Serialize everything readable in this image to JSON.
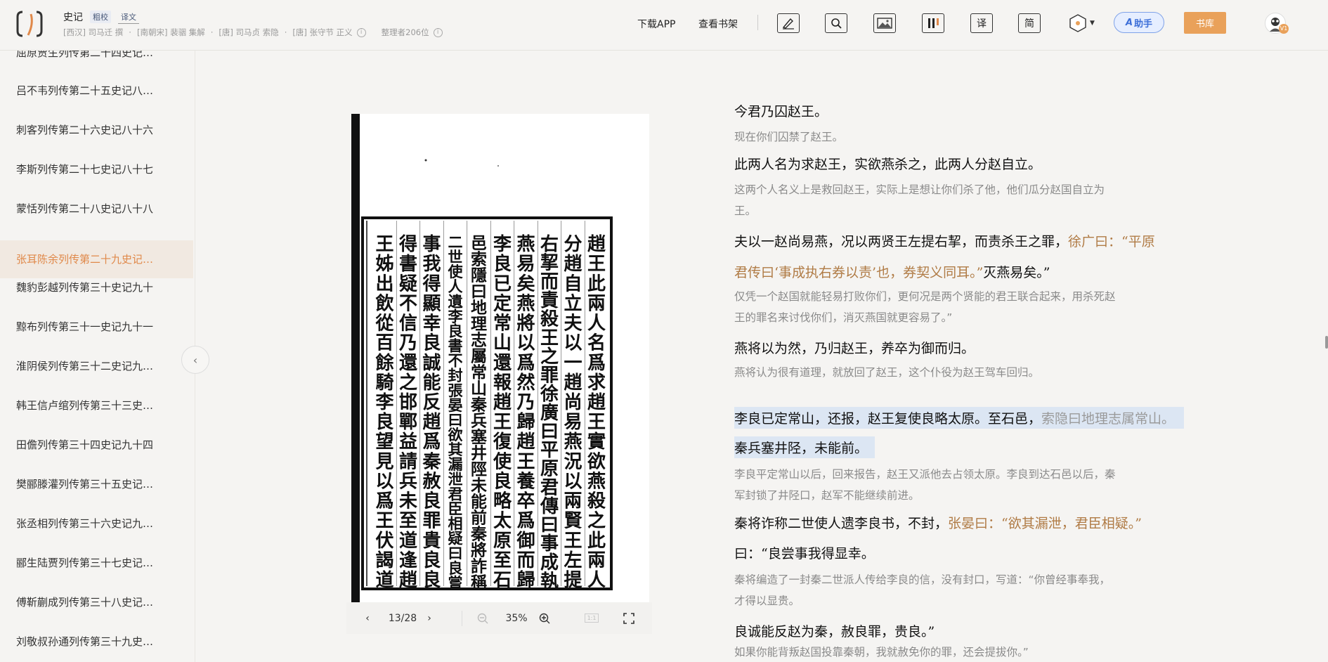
{
  "header": {
    "book_title": "史记",
    "tag_collate": "粗校",
    "tag_translate": "译文",
    "authors": [
      "[西汉] 司马迁 撰",
      "[南朝宋] 裴骃 集解",
      "[唐] 司马贞 索隐",
      "[唐] 张守节 正义"
    ],
    "editors": "整理者206位",
    "download_app": "下载APP",
    "view_shelf": "查看书架",
    "tools": [
      {
        "name": "annotate-icon",
        "glyph": "✎"
      },
      {
        "name": "search-icon",
        "glyph": "⌕"
      },
      {
        "name": "image-icon",
        "glyph": "▨"
      },
      {
        "name": "columns-icon",
        "glyph": "▥"
      },
      {
        "name": "translate-icon",
        "glyph": "译"
      },
      {
        "name": "simplified-icon",
        "glyph": "简"
      }
    ],
    "ai_label": "助手",
    "library_label": "书库",
    "avatar_badge": "V1",
    "colors": {
      "accent": "#e9a15a",
      "ai": "#3d6fd8",
      "note": "#b07b45",
      "highlight": "#dce6f3"
    }
  },
  "sidebar": {
    "items": [
      {
        "label": "屈原贾生列传第二十四史记…",
        "active": false
      },
      {
        "label": "吕不韦列传第二十五史记八…",
        "active": false
      },
      {
        "label": "刺客列传第二十六史记八十六",
        "active": false
      },
      {
        "label": "李斯列传第二十七史记八十七",
        "active": false
      },
      {
        "label": "蒙恬列传第二十八史记八十八",
        "active": false
      },
      {
        "label": "张耳陈余列传第二十九史记…",
        "active": true
      },
      {
        "label": "魏豹彭越列传第三十史记九十",
        "active": false
      },
      {
        "label": "黥布列传第三十一史记九十一",
        "active": false
      },
      {
        "label": "淮阴侯列传第三十二史记九…",
        "active": false
      },
      {
        "label": "韩王信卢绾列传第三十三史…",
        "active": false
      },
      {
        "label": "田儋列传第三十四史记九十四",
        "active": false
      },
      {
        "label": "樊郦滕灌列传第三十五史记…",
        "active": false
      },
      {
        "label": "张丞相列传第三十六史记九…",
        "active": false
      },
      {
        "label": "郦生陆贾列传第三十七史记…",
        "active": false
      },
      {
        "label": "傅靳蒯成列传第三十八史记…",
        "active": false
      },
      {
        "label": "刘敬叔孙通列传第三十九史…",
        "active": false
      }
    ]
  },
  "viewer": {
    "page_indicator": "13/28",
    "zoom": "35%",
    "ratio_label": "1:1",
    "scan_columns": [
      "趙王此兩人名爲求趙王實欲燕殺之此兩人",
      "分趙自立夫以一趙尚易燕況以兩賢王左提",
      "右挈而責殺王之罪徐廣曰平原君傳曰事成執",
      "燕易矣燕將以爲然乃歸趙王養卒爲御而歸",
      "李良已定常山還報趙王復使良略太原至石",
      "邑索隱曰地理志屬常山秦兵塞井陘未能前秦將詐稱",
      "二世使人遺李良書不封張晏曰欲其漏泄君臣相疑曰良嘗",
      "事我得顯幸良誠能反趙爲秦赦良罪貴良良",
      "得書疑不信乃還之邯鄲益請兵未至道逢趙",
      "王姊出飲從百餘騎李良望見以爲王伏謁道"
    ]
  },
  "text": {
    "lines": [
      {
        "kind": "orig",
        "text": "今君乃囚赵王。"
      },
      {
        "kind": "trans",
        "text": "现在你们囚禁了赵王。"
      },
      {
        "kind": "orig",
        "text": "此两人名为求赵王，实欲燕杀之，此两人分赵自立。"
      },
      {
        "kind": "trans",
        "text": "这两个人名义上是救回赵王，实际上是想让你们杀了他，他们瓜分赵国自立为"
      },
      {
        "kind": "trans",
        "text": "王。"
      },
      {
        "kind": "orig",
        "text": "夫以一赵尚易燕，况以两贤王左提右挈，而责杀王之罪，",
        "note": "徐广曰：“平原"
      },
      {
        "kind": "orig",
        "note_first": "君传曰‘事成执右券以责’也，券契义同耳。”",
        "text": "灭燕易矣。”"
      },
      {
        "kind": "trans",
        "text": "仅凭一个赵国就能轻易打败你们，更何况是两个贤能的君王联合起来，用杀死赵"
      },
      {
        "kind": "trans",
        "text": "王的罪名来讨伐你们，消灭燕国就更容易了。”"
      },
      {
        "kind": "orig",
        "text": "燕将以为然，乃归赵王，养卒为御而归。"
      },
      {
        "kind": "trans",
        "text": "燕将认为很有道理，就放回了赵王，这个仆役为赵王驾车回归。"
      },
      {
        "kind": "orig",
        "highlight": true,
        "text": "李良已定常山，还报，赵王复使良略太原。至石邑，",
        "note": "索隐曰地理志属常山。"
      },
      {
        "kind": "orig",
        "highlight": true,
        "text": "秦兵塞井陉，未能前。"
      },
      {
        "kind": "trans",
        "text": "李良平定常山以后，回来报告，赵王又派他去占领太原。李良到达石邑以后，秦"
      },
      {
        "kind": "trans",
        "text": "军封锁了井陉口，赵军不能继续前进。"
      },
      {
        "kind": "orig",
        "text": "秦将诈称二世使人遗李良书，不封，",
        "note": "张晏曰：“欲其漏泄，君臣相疑。”"
      },
      {
        "kind": "orig",
        "text": "曰：“良尝事我得显幸。"
      },
      {
        "kind": "trans",
        "text": "秦将编造了一封秦二世派人传给李良的信，没有封口，写道：“你曾经事奉我，"
      },
      {
        "kind": "trans",
        "text": "才得以显贵。"
      },
      {
        "kind": "orig",
        "text": "良诚能反赵为秦，赦良罪，贵良。”"
      },
      {
        "kind": "trans",
        "text": "如果你能背叛赵国投靠秦朝，我就赦免你的罪，还会提拔你。”"
      }
    ]
  }
}
